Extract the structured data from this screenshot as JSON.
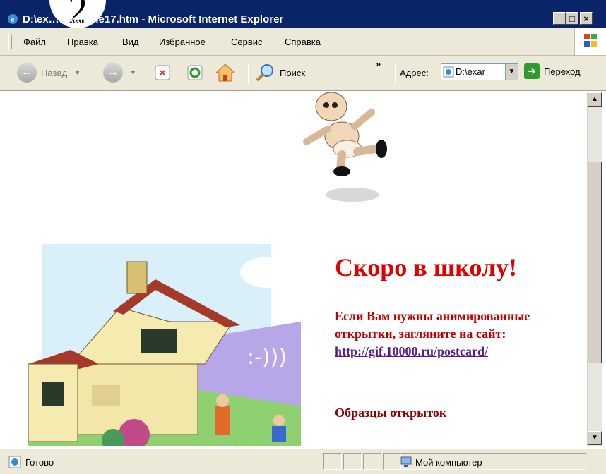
{
  "window": {
    "title": "D:\\ex…\\example17.htm - Microsoft Internet Explorer",
    "badge": "2",
    "buttons": [
      "_",
      "□",
      "×"
    ]
  },
  "menu": [
    "Файл",
    "Правка",
    "Вид",
    "Избранное",
    "Сервис",
    "Справка"
  ],
  "toolbar": {
    "back_label": "Назад",
    "search_label": "Поиск",
    "address_label": "Адрес:",
    "address_value": "D:\\exar",
    "go_label": "Переход",
    "chevron": "»"
  },
  "page": {
    "heading": "Скоро в школу!",
    "paragraph": "Если Вам нужны анимированные открытки, загляните на сайт:",
    "link": "http://gif.10000.ru/postcard/",
    "samples_link": "Образцы открыток"
  },
  "status": {
    "text": "Готово",
    "zone": "Мой компьютер"
  }
}
